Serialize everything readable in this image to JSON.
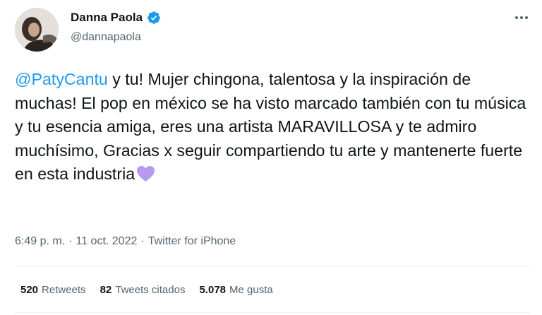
{
  "author": {
    "display_name": "Danna Paola",
    "handle": "@dannapaola",
    "verified": true
  },
  "tweet": {
    "mention": "@PatyCantu",
    "text_after_mention": " y tu! Mujer chingona, talentosa y la inspiración de muchas! El pop en méxico se ha visto marcado también con tu música y tu esencia amiga, eres una artista MARAVILLOSA y te admiro muchísimo, Gracias x seguir compartiendo tu arte y mantenerte fuerte en esta industria",
    "emoji": "purple-heart"
  },
  "meta": {
    "time": "6:49 p. m.",
    "sep1": "·",
    "date": "11 oct. 2022",
    "sep2": "·",
    "source": "Twitter for iPhone"
  },
  "stats": [
    {
      "count": "520",
      "label": "Retweets"
    },
    {
      "count": "82",
      "label": "Tweets citados"
    },
    {
      "count": "5.078",
      "label": "Me gusta"
    }
  ],
  "colors": {
    "link": "#1d9bf0",
    "secondary_text": "#536471",
    "verified_badge": "#1d9bf0",
    "heart": "#b69af0"
  },
  "icons": {
    "verified": "verified-badge-icon",
    "more": "more-options-icon",
    "heart": "purple-heart-icon"
  }
}
